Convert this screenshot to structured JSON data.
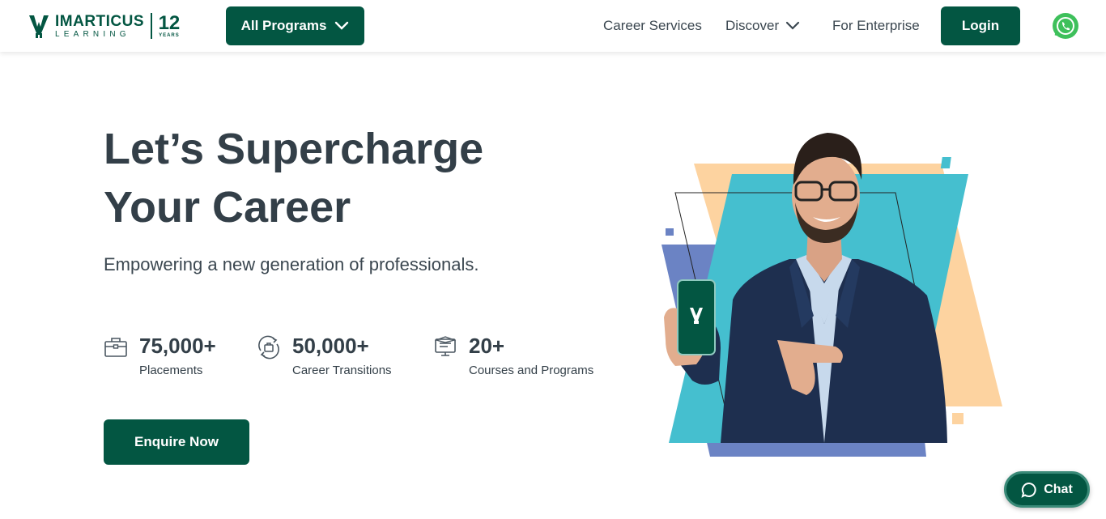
{
  "colors": {
    "brand": "#035642",
    "text": "#333f48",
    "accent_teal": "#45bfcf",
    "accent_peach": "#fdd3a0",
    "accent_blue": "#6b83c4"
  },
  "header": {
    "logo": {
      "brand": "IMARTICUS",
      "sub": "LEARNING",
      "years_number": "12",
      "years_label": "YEARS"
    },
    "programs_label": "All Programs",
    "nav": {
      "career_services": "Career Services",
      "discover": "Discover",
      "enterprise": "For Enterprise"
    },
    "login_label": "Login",
    "whatsapp_icon": "whatsapp-icon"
  },
  "hero": {
    "title_line1": "Let’s Supercharge",
    "title_line2": "Your Career",
    "subtitle": "Empowering a new generation of professionals.",
    "stats": [
      {
        "icon": "briefcase-icon",
        "value": "75,000+",
        "label": "Placements"
      },
      {
        "icon": "career-transition-icon",
        "value": "50,000+",
        "label": "Career Transitions"
      },
      {
        "icon": "courses-icon",
        "value": "20+",
        "label": "Courses and Programs"
      }
    ],
    "cta_label": "Enquire Now"
  },
  "chat": {
    "label": "Chat",
    "icon": "chat-bubble-icon"
  }
}
